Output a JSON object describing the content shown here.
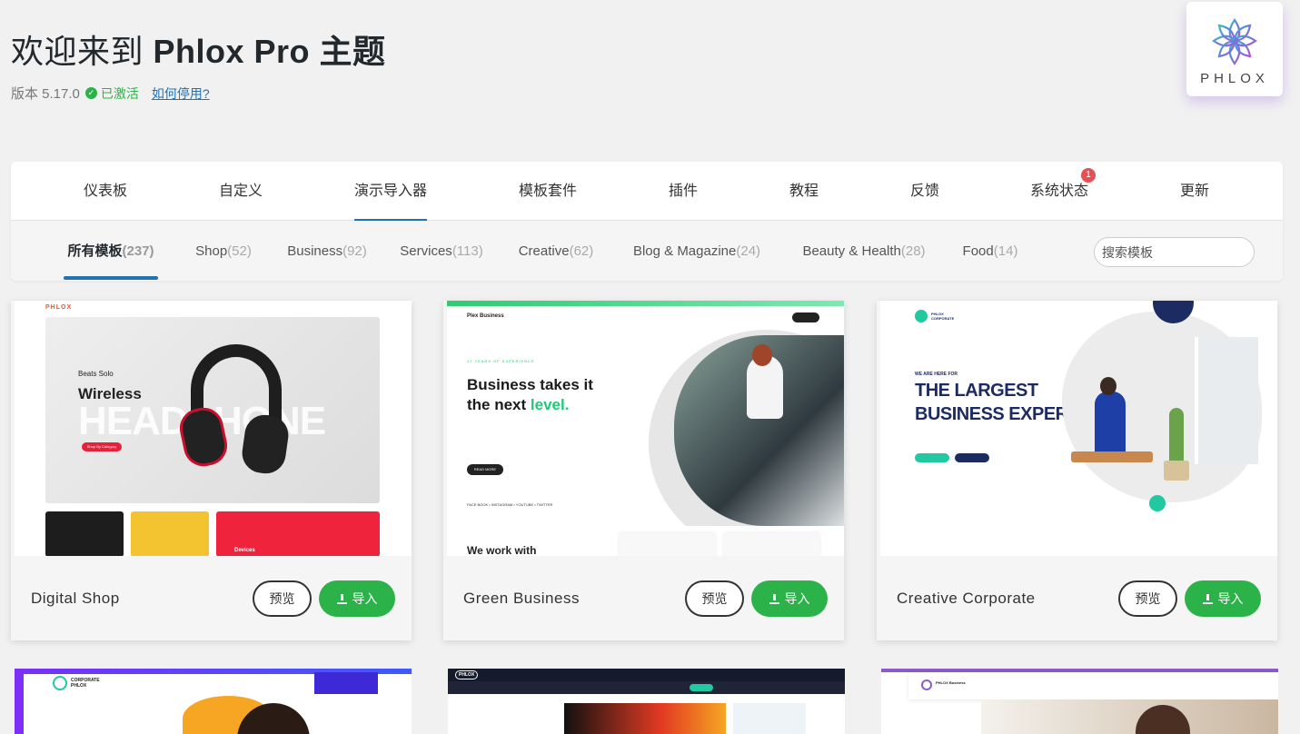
{
  "header": {
    "title_prefix": "欢迎来到 ",
    "title_bold": "Phlox Pro 主题",
    "version": "版本 5.17.0",
    "activated": "已激活",
    "deactivate_link": "如何停用?"
  },
  "logo": {
    "text": "PHLOX"
  },
  "main_tabs": [
    {
      "label": "仪表板"
    },
    {
      "label": "自定义"
    },
    {
      "label": "演示导入器"
    },
    {
      "label": "模板套件"
    },
    {
      "label": "插件"
    },
    {
      "label": "教程"
    },
    {
      "label": "反馈"
    },
    {
      "label": "系统状态",
      "badge": "1"
    },
    {
      "label": "更新"
    }
  ],
  "sub_tabs": [
    {
      "label": "所有模板",
      "count": "(237)"
    },
    {
      "label": "Shop",
      "count": "(52)"
    },
    {
      "label": "Business",
      "count": "(92)"
    },
    {
      "label": "Services",
      "count": "(113)"
    },
    {
      "label": "Creative",
      "count": "(62)"
    },
    {
      "label": "Blog & Magazine",
      "count": "(24)"
    },
    {
      "label": "Beauty & Health",
      "count": "(28)"
    },
    {
      "label": "Food",
      "count": "(14)"
    }
  ],
  "search": {
    "placeholder": "搜索模板"
  },
  "buttons": {
    "preview": "预览",
    "import": "导入"
  },
  "cards": [
    {
      "name": "Digital Shop"
    },
    {
      "name": "Green Business"
    },
    {
      "name": "Creative Corporate"
    }
  ],
  "thumbs": {
    "shop_brand": "PHLOX",
    "shop_small": "Beats Solo",
    "shop_wireless": "Wireless",
    "shop_big": "HEADPHONE",
    "shop_btn": "Shop By Category",
    "shop_tile_label": "Devices",
    "biz_brand": "Plex Business",
    "biz_kicker": "17 YEARS OF EXPERIENCE",
    "biz_line1": "Business takes it",
    "biz_line2": "the next ",
    "biz_line2_accent": "level.",
    "biz_btn": "READ MORE",
    "biz_social": "FACE BOOK • INSTAGRAM • YOUTUBE • TWITTER",
    "biz_bottom": "We work with",
    "corp_brand": "PHLOX CORPORATE",
    "corp_kicker": "WE ARE HERE FOR",
    "corp_line1": "THE LARGEST",
    "corp_line2": "BUSINESS EXPERT",
    "row2_a": "CORPORATE PHLOX",
    "row2_b": "PHLOX",
    "row2_c": "PHLOX Business"
  },
  "colors": {
    "accent": "#2271b1",
    "green": "#2bb34a",
    "badge": "#e65054"
  }
}
